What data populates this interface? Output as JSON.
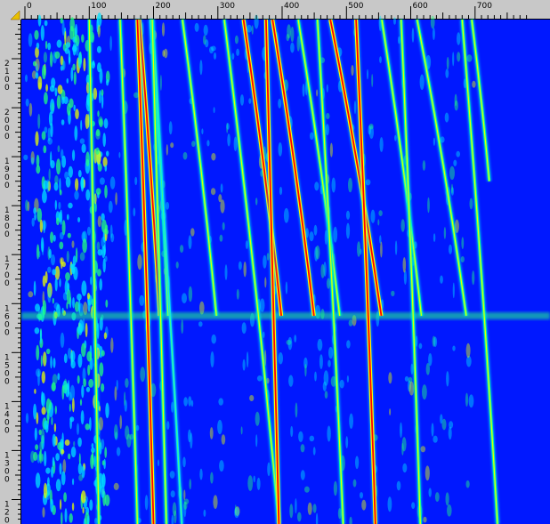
{
  "chart_data": {
    "type": "heatmap",
    "title": "",
    "xlabel": "",
    "ylabel": "",
    "x_ticks": [
      0,
      100,
      200,
      300,
      400,
      500,
      600,
      700
    ],
    "y_ticks": [
      2100,
      2000,
      1900,
      1800,
      1700,
      1600,
      1500,
      1400,
      1300,
      1200
    ],
    "xlim": [
      0,
      780
    ],
    "ylim": [
      1150,
      2180
    ],
    "y_axis_direction": "decreasing-downward",
    "grid": false,
    "legend": "none",
    "colormap": [
      "#0018ff",
      "#00e0ff",
      "#20ff80",
      "#e8ff00",
      "#ff0000"
    ],
    "background_color": "#0018ff",
    "transition_y": 1575,
    "tracks": [
      {
        "x_top": 100,
        "x_bottom": 115,
        "y_end": 1150,
        "intensity": "medium"
      },
      {
        "x_top": 148,
        "x_bottom": 175,
        "y_end": 1150,
        "intensity": "medium"
      },
      {
        "x_top": 198,
        "x_bottom": 240,
        "y_end": 1575,
        "intensity": "medium"
      },
      {
        "x_top": 195,
        "x_bottom": 244,
        "y_end": 1150,
        "intensity": "low"
      },
      {
        "x_top": 178,
        "x_bottom": 232,
        "y_end": 1575,
        "intensity": "high"
      },
      {
        "x_top": 198,
        "x_bottom": 220,
        "y_end": 1150,
        "intensity": "medium"
      },
      {
        "x_top": 175,
        "x_bottom": 200,
        "y_end": 1150,
        "intensity": "high"
      },
      {
        "x_top": 245,
        "x_bottom": 335,
        "y_end": 1575,
        "intensity": "medium"
      },
      {
        "x_top": 340,
        "x_bottom": 440,
        "y_end": 1575,
        "intensity": "high"
      },
      {
        "x_top": 385,
        "x_bottom": 495,
        "y_end": 1575,
        "intensity": "high"
      },
      {
        "x_top": 425,
        "x_bottom": 535,
        "y_end": 1575,
        "intensity": "medium"
      },
      {
        "x_top": 475,
        "x_bottom": 610,
        "y_end": 1575,
        "intensity": "high"
      },
      {
        "x_top": 555,
        "x_bottom": 660,
        "y_end": 1575,
        "intensity": "medium"
      },
      {
        "x_top": 610,
        "x_bottom": 740,
        "y_end": 1575,
        "intensity": "medium"
      },
      {
        "x_top": 695,
        "x_bottom": 780,
        "y_end": 1850,
        "intensity": "medium"
      },
      {
        "x_top": 310,
        "x_bottom": 395,
        "y_end": 1150,
        "intensity": "medium"
      },
      {
        "x_top": 375,
        "x_bottom": 395,
        "y_end": 1150,
        "intensity": "high"
      },
      {
        "x_top": 455,
        "x_bottom": 495,
        "y_end": 1150,
        "intensity": "medium"
      },
      {
        "x_top": 515,
        "x_bottom": 545,
        "y_end": 1150,
        "intensity": "high"
      },
      {
        "x_top": 585,
        "x_bottom": 615,
        "y_end": 1150,
        "intensity": "medium"
      },
      {
        "x_top": 680,
        "x_bottom": 735,
        "y_end": 1150,
        "intensity": "medium"
      }
    ],
    "noise_band": {
      "x_start": 15,
      "x_end": 130,
      "intensity": "high"
    }
  }
}
